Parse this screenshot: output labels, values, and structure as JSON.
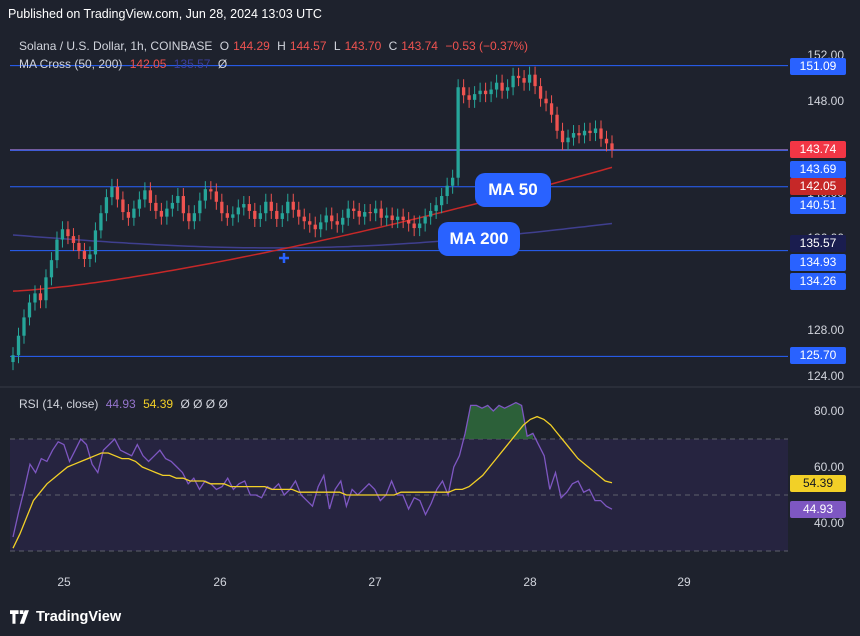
{
  "header": {
    "published": "Published on TradingView.com, Jun 28, 2024 13:03 UTC"
  },
  "legend": {
    "symbol": "Solana / U.S. Dollar, 1h, COINBASE",
    "o_label": "O",
    "o_value": "144.29",
    "h_label": "H",
    "h_value": "144.57",
    "l_label": "L",
    "l_value": "143.70",
    "c_label": "C",
    "c_value": "143.74",
    "change": "−0.53 (−0.37%)",
    "ma_cross_label": "MA Cross (50, 200)",
    "ma50_value": "142.05",
    "ma200_value": "135.57",
    "ma_extra": "Ø",
    "rsi_label": "RSI (14, close)",
    "rsi_value": "44.93",
    "rsi_ma_value": "54.39",
    "rsi_extra": "Ø Ø Ø Ø"
  },
  "callouts": {
    "ma50": "MA 50",
    "ma200": "MA 200"
  },
  "price_axis": {
    "ticks": [
      "152.00",
      "148.00",
      "140.00",
      "136.00",
      "128.00",
      "124.00"
    ],
    "tags": [
      {
        "label": "151.09",
        "color": "#2962ff"
      },
      {
        "label": "143.74",
        "color": "#f23645"
      },
      {
        "label": "143.69",
        "color": "#2962ff"
      },
      {
        "label": "142.05",
        "color": "#c62828"
      },
      {
        "label": "140.51",
        "color": "#2962ff"
      },
      {
        "label": "135.57",
        "color": "#1a1d4f"
      },
      {
        "label": "134.93",
        "color": "#2962ff"
      },
      {
        "label": "134.26",
        "color": "#2962ff"
      },
      {
        "label": "125.70",
        "color": "#2962ff"
      }
    ]
  },
  "rsi_axis": {
    "ticks": [
      "80.00",
      "60.00",
      "40.00"
    ],
    "tags": [
      {
        "label": "54.39",
        "color": "#f2d027"
      },
      {
        "label": "44.93",
        "color": "#7e57c2"
      }
    ]
  },
  "time_axis": [
    "25",
    "26",
    "27",
    "28",
    "29"
  ],
  "brand": {
    "name": "TradingView"
  },
  "colors": {
    "up": "#26a69a",
    "down": "#ef5350",
    "ma50": "#c62828",
    "ma200": "#3f3f8f",
    "hline": "#2962ff",
    "rsi": "#7e57c2",
    "rsi_ma": "#f2d027"
  },
  "chart_data": [
    {
      "type": "candlestick",
      "title": "Solana / U.S. Dollar, 1h, COINBASE",
      "x_labels": [
        "25",
        "26",
        "27",
        "28",
        "29"
      ],
      "ylim": [
        124,
        153
      ],
      "horizontal_levels": [
        151.09,
        143.69,
        140.51,
        134.93,
        125.7
      ],
      "current_price": 143.74,
      "close_series": [
        125.8,
        127.5,
        129.1,
        130.4,
        131.2,
        130.6,
        132.6,
        134.1,
        135.9,
        136.8,
        136.2,
        135.6,
        134.9,
        134.2,
        134.6,
        136.7,
        138.2,
        139.6,
        140.5,
        139.4,
        138.3,
        137.8,
        138.6,
        139.4,
        140.2,
        139.1,
        138.4,
        137.9,
        138.6,
        139.1,
        139.7,
        138.2,
        137.5,
        138.2,
        139.3,
        140.3,
        140.1,
        139.2,
        138.2,
        137.8,
        138.1,
        138.7,
        139.0,
        138.4,
        137.7,
        138.2,
        139.2,
        138.4,
        137.7,
        138.2,
        139.2,
        138.5,
        137.9,
        137.5,
        137.2,
        136.8,
        137.4,
        138.0,
        137.5,
        137.2,
        137.8,
        138.6,
        138.4,
        137.9,
        138.3,
        138.2,
        138.6,
        137.8,
        138.0,
        137.6,
        137.9,
        137.6,
        137.3,
        136.9,
        137.3,
        137.9,
        138.4,
        138.9,
        139.7,
        140.6,
        141.3,
        149.2,
        148.5,
        148.1,
        148.6,
        148.9,
        148.6,
        149.0,
        149.6,
        148.9,
        149.2,
        150.2,
        150.0,
        149.6,
        150.3,
        149.3,
        148.2,
        147.8,
        146.8,
        145.4,
        144.4,
        144.8,
        145.2,
        145.0,
        145.4,
        145.2,
        145.6,
        144.7,
        144.3,
        143.74
      ],
      "series": [
        {
          "name": "MA 50",
          "value": 142.05
        },
        {
          "name": "MA 200",
          "value": 135.57
        }
      ]
    },
    {
      "type": "line",
      "title": "RSI (14, close)",
      "ylim": [
        30,
        82
      ],
      "bands": [
        30,
        70
      ],
      "rsi_values": [
        35,
        44,
        52,
        61,
        58,
        63,
        62,
        66,
        69,
        68,
        62,
        66,
        70,
        68,
        61,
        58,
        66,
        68,
        70,
        66,
        65,
        64,
        68,
        64,
        62,
        64,
        66,
        63,
        62,
        60,
        58,
        54,
        56,
        52,
        55,
        54,
        52,
        53,
        56,
        52,
        54,
        55,
        50,
        50,
        49,
        53,
        52,
        54,
        50,
        52,
        55,
        50,
        48,
        46,
        53,
        57,
        45,
        52,
        55,
        46,
        52,
        50,
        52,
        54,
        52,
        48,
        50,
        55,
        50,
        50,
        45,
        49,
        48,
        43,
        47,
        52,
        55,
        50,
        60,
        64,
        72,
        82,
        82,
        81,
        82,
        80,
        82,
        81,
        82,
        83,
        82,
        71,
        72,
        68,
        64,
        52,
        58,
        49,
        51,
        54,
        55,
        51,
        52,
        48,
        48,
        46,
        44.93
      ],
      "rsi_ma_values": [
        31,
        36,
        42,
        48,
        51,
        54,
        56,
        58,
        60,
        61,
        62,
        63,
        64,
        65,
        65,
        64,
        63,
        63,
        62,
        60,
        59,
        58,
        57,
        57,
        56,
        56,
        55,
        55,
        55,
        54,
        54,
        54,
        53,
        53,
        53,
        53,
        53,
        53,
        52,
        52,
        52,
        52,
        51,
        51,
        51,
        51,
        51,
        51,
        51,
        50,
        50,
        50,
        50,
        50,
        50,
        50,
        50,
        51,
        51,
        51,
        51,
        51,
        51,
        51,
        51,
        52,
        52,
        53,
        55,
        57,
        60,
        63,
        66,
        69,
        72,
        75,
        77,
        78,
        77,
        75,
        72,
        69,
        66,
        63,
        61,
        59,
        57,
        55,
        54.39
      ]
    }
  ]
}
